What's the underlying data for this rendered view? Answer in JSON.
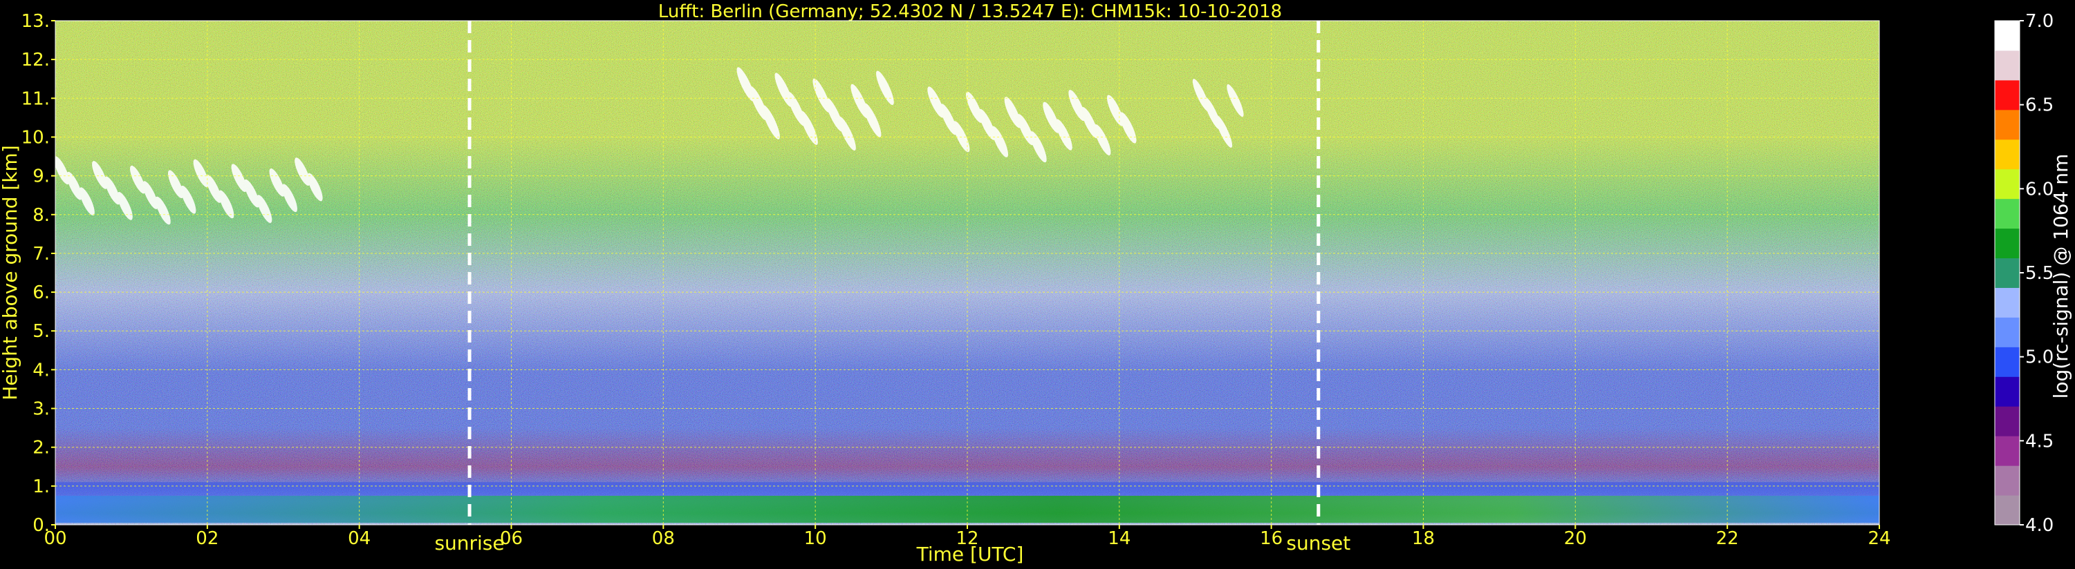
{
  "chart_data": {
    "type": "heatmap",
    "title": "Lufft: Berlin (Germany; 52.4302 N / 13.5247 E):    CHM15k: 10-10-2018",
    "xlabel": "Time [UTC]",
    "ylabel": "Height above ground [km]",
    "xlim": [
      0,
      24
    ],
    "ylim": [
      0,
      13
    ],
    "x_ticks": [
      0,
      2,
      4,
      6,
      8,
      10,
      12,
      14,
      16,
      18,
      20,
      22,
      24
    ],
    "x_tick_labels": [
      "00",
      "02",
      "04",
      "06",
      "08",
      "10",
      "12",
      "14",
      "16",
      "18",
      "20",
      "22",
      "24"
    ],
    "y_ticks": [
      0,
      1,
      2,
      3,
      4,
      5,
      6,
      7,
      8,
      9,
      10,
      11,
      12,
      13
    ],
    "y_tick_labels": [
      "0.",
      "1.",
      "2.",
      "3.",
      "4.",
      "5.",
      "6.",
      "7.",
      "8.",
      "9.",
      "10.",
      "11.",
      "12.",
      "13."
    ],
    "grid": true,
    "colorbar": {
      "label": "log(rc-signal) @ 1064 nm",
      "range": [
        4.0,
        7.0
      ],
      "ticks": [
        4.0,
        4.5,
        5.0,
        5.5,
        6.0,
        6.5,
        7.0
      ],
      "tick_labels": [
        "4.0",
        "4.5",
        "5.0",
        "5.5",
        "6.0",
        "6.5",
        "7.0"
      ],
      "colors": [
        "#a890a8",
        "#a878a8",
        "#983098",
        "#6a1088",
        "#2800b8",
        "#2a50f8",
        "#6890ff",
        "#a0b8ff",
        "#2a9870",
        "#10a020",
        "#50d850",
        "#c8f820",
        "#ffcc00",
        "#ff8000",
        "#ff1010",
        "#e8d0d8",
        "#ffffff"
      ]
    },
    "annotations": [
      {
        "label": "sunrise",
        "x": 5.45
      },
      {
        "label": "sunset",
        "x": 16.62
      }
    ],
    "profile": [
      {
        "height": 0.1,
        "value": 5.4
      },
      {
        "height": 0.3,
        "value": 5.6
      },
      {
        "height": 0.6,
        "value": 5.2
      },
      {
        "height": 1.0,
        "value": 4.9
      },
      {
        "height": 1.5,
        "value": 4.6
      },
      {
        "height": 2.5,
        "value": 4.9
      },
      {
        "height": 4.0,
        "value": 5.0
      },
      {
        "height": 6.0,
        "value": 5.4
      },
      {
        "height": 8.0,
        "value": 5.8
      },
      {
        "height": 10.0,
        "value": 6.0
      },
      {
        "height": 12.5,
        "value": 6.1
      }
    ],
    "cloud_layers": [
      {
        "time_start": 0.0,
        "time_end": 3.5,
        "base_km": 7.7,
        "top_km": 9.5
      },
      {
        "time_start": 9.0,
        "time_end": 11.0,
        "base_km": 9.6,
        "top_km": 11.8
      },
      {
        "time_start": 11.5,
        "time_end": 14.2,
        "base_km": 9.3,
        "top_km": 11.3
      },
      {
        "time_start": 15.0,
        "time_end": 15.6,
        "base_km": 9.4,
        "top_km": 11.5
      }
    ]
  }
}
